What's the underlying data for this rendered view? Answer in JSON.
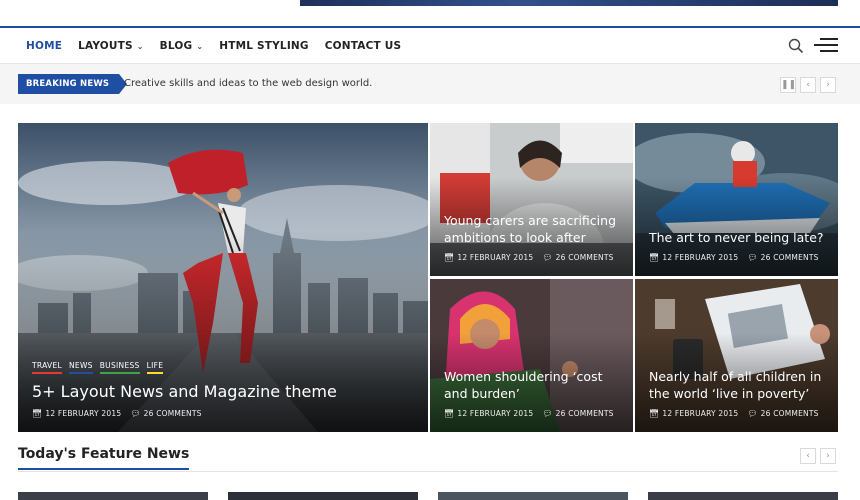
{
  "nav": {
    "items": [
      {
        "label": "HOME",
        "dropdown": false,
        "active": true
      },
      {
        "label": "LAYOUTS",
        "dropdown": true,
        "active": false
      },
      {
        "label": "BLOG",
        "dropdown": true,
        "active": false
      },
      {
        "label": "HTML STYLING",
        "dropdown": false,
        "active": false
      },
      {
        "label": "CONTACT US",
        "dropdown": false,
        "active": false
      }
    ],
    "icons": {
      "search": "search-icon",
      "menu": "hamburger-menu-icon"
    }
  },
  "ticker": {
    "label": "BREAKING NEWS",
    "text": "Creative skills and ideas to the web design world.",
    "controls": [
      "pause-icon",
      "chevron-left-icon",
      "chevron-right-icon"
    ]
  },
  "hero": {
    "main": {
      "categories": [
        {
          "label": "TRAVEL",
          "color": "#e53935"
        },
        {
          "label": "NEWS",
          "color": "#1f4fa3"
        },
        {
          "label": "BUSINESS",
          "color": "#43a047"
        },
        {
          "label": "LIFE",
          "color": "#fdd835"
        }
      ],
      "title": "5+ Layout News and Magazine theme",
      "date": "12 FEBRUARY 2015",
      "comments": "26 COMMENTS"
    },
    "tiles": [
      {
        "title": "Young carers are sacrificing ambitions to look after",
        "date": "12 FEBRUARY 2015",
        "comments": "26 COMMENTS"
      },
      {
        "title": "The art to never being late?",
        "date": "12 FEBRUARY 2015",
        "comments": "26 COMMENTS"
      },
      {
        "title": "Women shouldering ‘cost and burden’",
        "date": "12 FEBRUARY 2015",
        "comments": "26 COMMENTS"
      },
      {
        "title": "Nearly half of all children in the world ‘live in poverty’",
        "date": "12 FEBRUARY 2015",
        "comments": "26 COMMENTS"
      }
    ]
  },
  "feature": {
    "title": "Today's Feature News"
  },
  "colors": {
    "accent": "#1f4fa3",
    "ticker_bg": "#f5f5f5"
  }
}
